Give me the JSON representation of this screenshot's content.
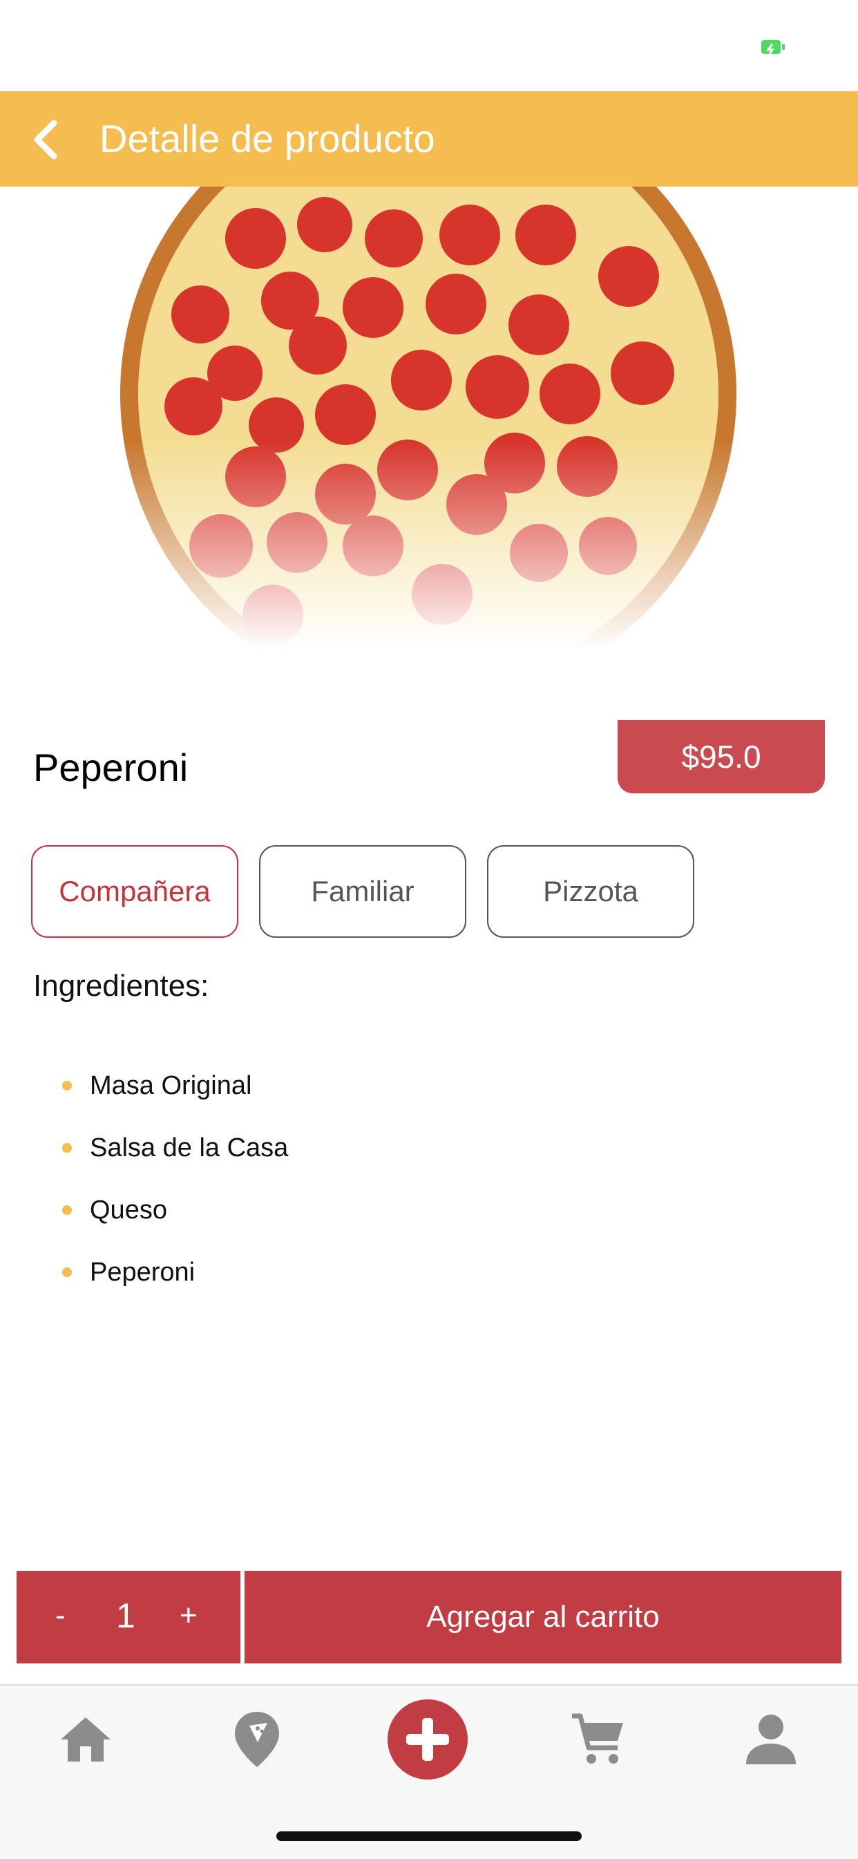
{
  "header": {
    "title": "Detalle de producto"
  },
  "product": {
    "name": "Peperoni",
    "price": "$95.0",
    "sizes": [
      {
        "label": "Compañera",
        "selected": true
      },
      {
        "label": "Familiar",
        "selected": false
      },
      {
        "label": "Pizzota",
        "selected": false
      }
    ],
    "ingredients_heading": "Ingredientes:",
    "ingredients": [
      "Masa Original",
      "Salsa de la Casa",
      "Queso",
      "Peperoni"
    ]
  },
  "cart": {
    "minus_label": "-",
    "quantity": "1",
    "plus_label": "+",
    "add_label": "Agregar al carrito"
  },
  "tab_bar": {
    "items": [
      {
        "icon": "home-icon"
      },
      {
        "icon": "pizza-location-icon"
      },
      {
        "icon": "add-icon"
      },
      {
        "icon": "cart-icon"
      },
      {
        "icon": "user-icon"
      }
    ]
  },
  "colors": {
    "accent_yellow": "#f5bd4f",
    "accent_red": "#c13c43",
    "price_red": "#c94a4f",
    "icon_gray": "#8c8c8c",
    "battery_green": "#4cd964"
  }
}
